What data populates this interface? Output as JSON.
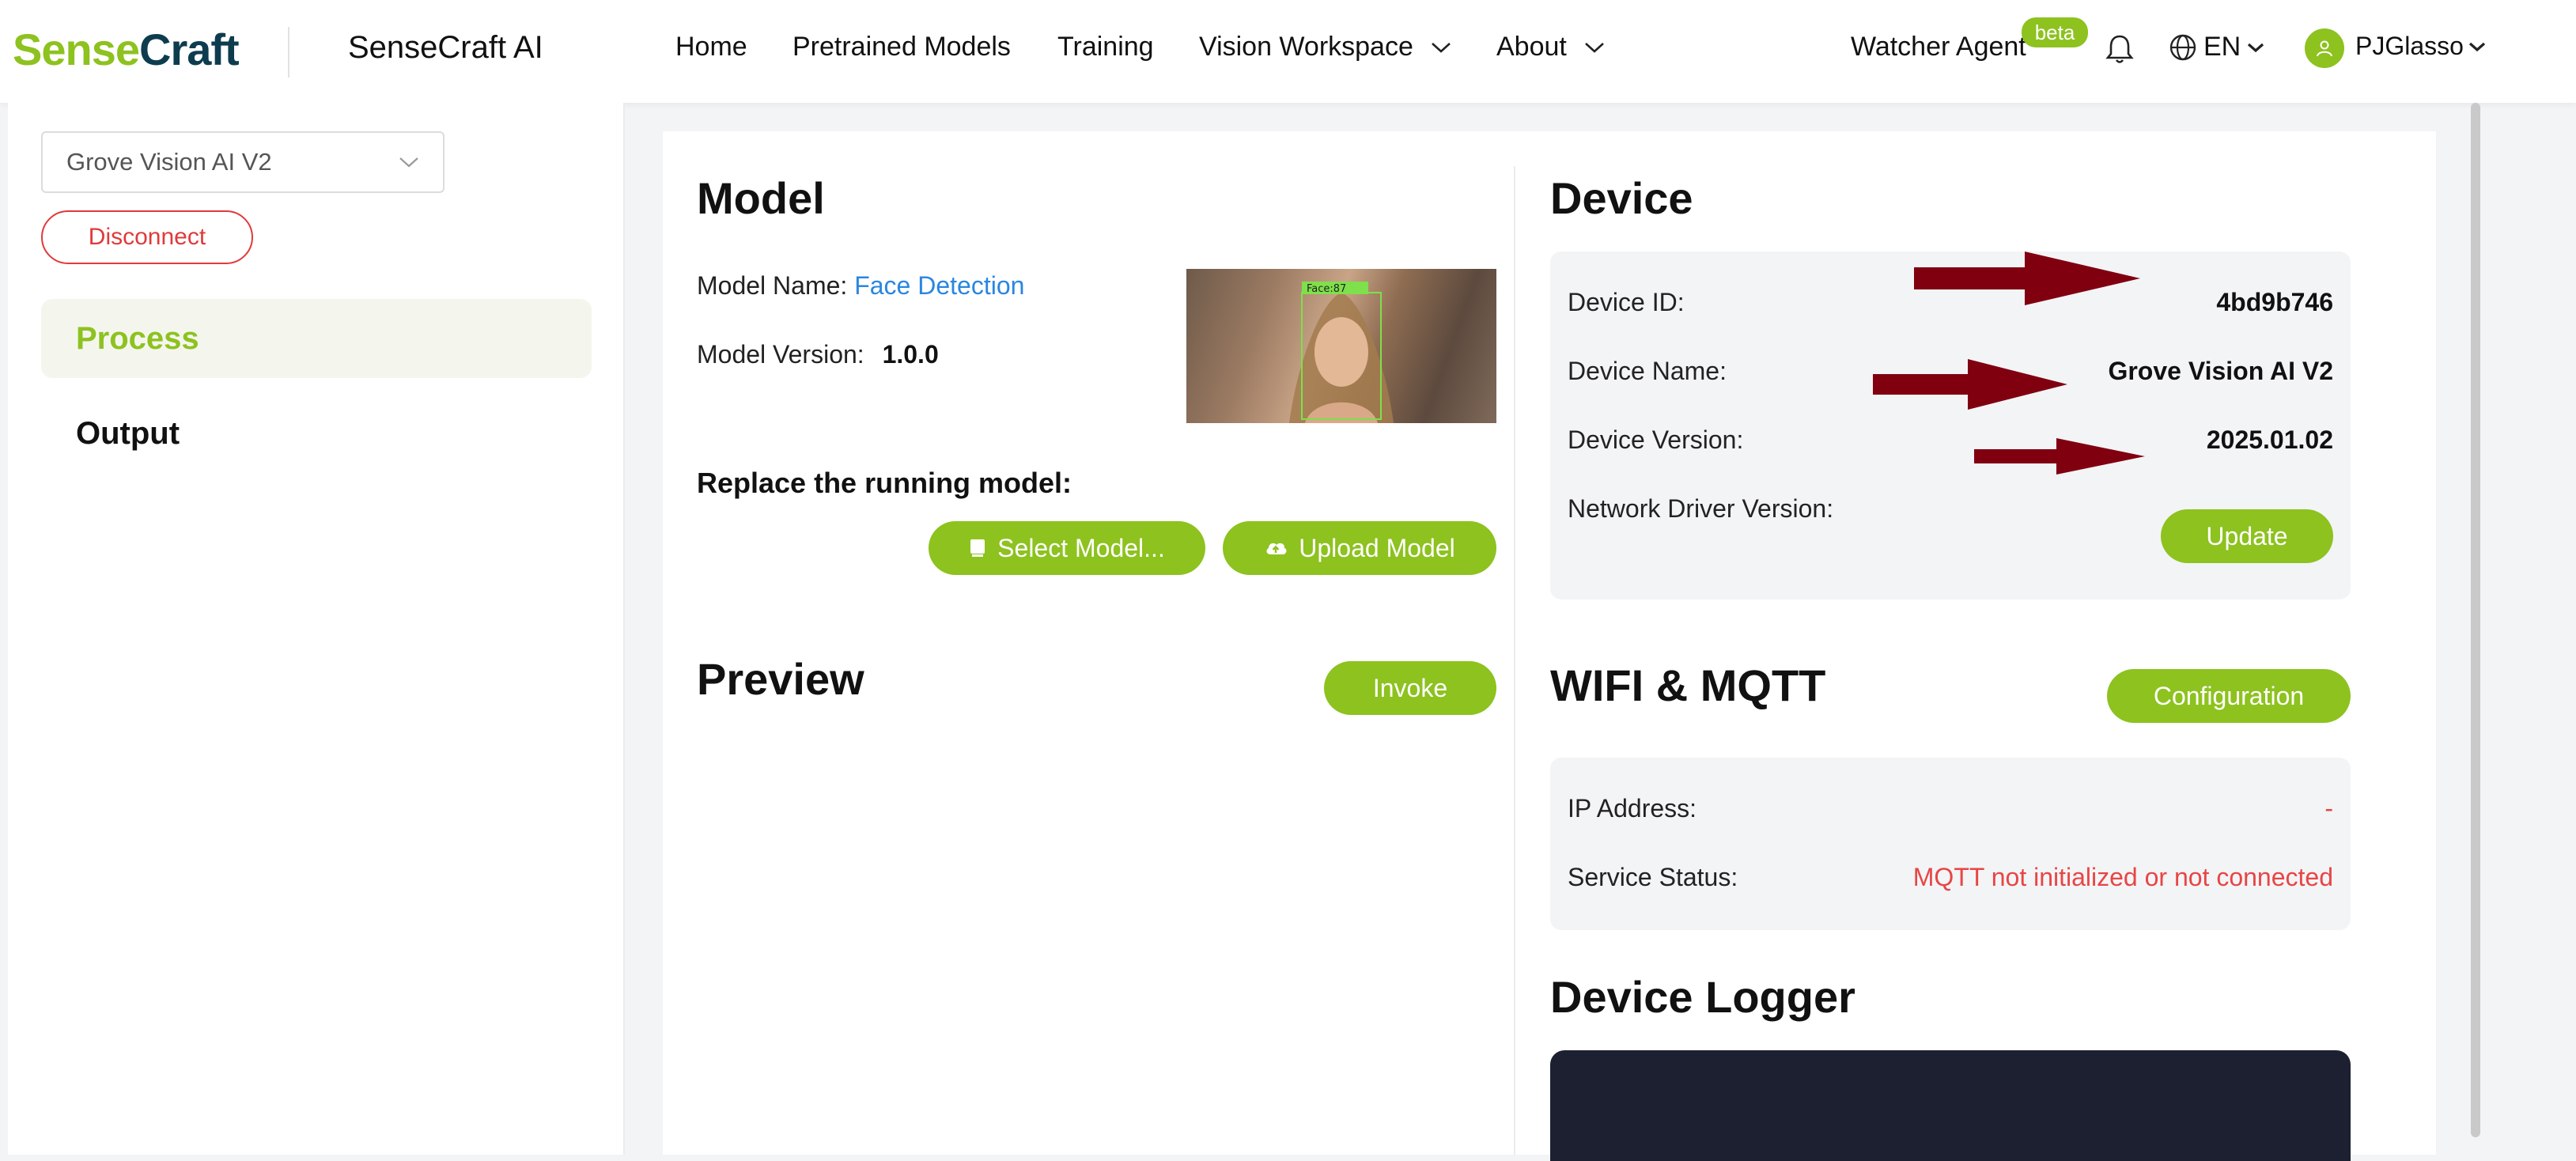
{
  "colors": {
    "accent": "#8dc21f",
    "link": "#2a86e0",
    "danger": "#e84545",
    "arrow": "#800010",
    "logger_bg": "#1c2030"
  },
  "header": {
    "logo_part1": "Sense",
    "logo_part2": "Craft",
    "brand": "SenseCraft AI",
    "nav": [
      "Home",
      "Pretrained Models",
      "Training",
      "Vision Workspace",
      "About"
    ],
    "agent_label": "Watcher Agent",
    "beta_badge": "beta",
    "language": "EN",
    "username": "PJGlasso"
  },
  "sidebar": {
    "device_select_value": "Grove Vision AI V2",
    "disconnect_label": "Disconnect",
    "items": [
      {
        "label": "Process",
        "active": true
      },
      {
        "label": "Output",
        "active": false
      }
    ]
  },
  "model": {
    "title": "Model",
    "name_label": "Model Name:",
    "name_value": "Face Detection",
    "version_label": "Model Version:",
    "version_value": "1.0.0",
    "image_tag": "Face:87",
    "replace_label": "Replace the running model:",
    "select_button": "Select Model...",
    "upload_button": "Upload Model"
  },
  "preview": {
    "title": "Preview",
    "invoke_button": "Invoke"
  },
  "device": {
    "title": "Device",
    "id_label": "Device ID:",
    "id_value": "4bd9b746",
    "name_label": "Device Name:",
    "name_value": "Grove Vision AI V2",
    "version_label": "Device Version:",
    "version_value": "2025.01.02",
    "network_label": "Network Driver Version:",
    "update_button": "Update"
  },
  "wifi": {
    "title": "WIFI & MQTT",
    "config_button": "Configuration",
    "ip_label": "IP Address:",
    "ip_value": "-",
    "status_label": "Service Status:",
    "status_value": "MQTT not initialized or not connected"
  },
  "logger": {
    "title": "Device Logger"
  }
}
